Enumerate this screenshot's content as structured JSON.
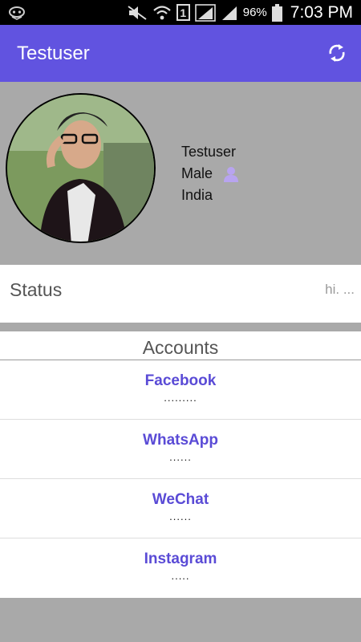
{
  "statusbar": {
    "battery_pct": "96%",
    "sim_slot": "1",
    "time": "7:03 PM",
    "icons": [
      "notification-icon",
      "mute-icon",
      "wifi-icon",
      "sim-1-icon",
      "signal-icon",
      "signal-icon",
      "battery-icon"
    ]
  },
  "appbar": {
    "title": "Testuser",
    "refresh_icon": "refresh-icon",
    "bg_color": "#6153e0"
  },
  "profile": {
    "name": "Testuser",
    "gender": "Male",
    "country": "India",
    "gender_icon": "person-icon"
  },
  "status": {
    "label": "Status",
    "value": "hi. ..."
  },
  "accounts": {
    "header": "Accounts",
    "items": [
      {
        "name": "Facebook",
        "value": "........."
      },
      {
        "name": "WhatsApp",
        "value": "......"
      },
      {
        "name": "WeChat",
        "value": "......"
      },
      {
        "name": "Instagram",
        "value": "....."
      }
    ],
    "accent_color": "#5a4bd6"
  }
}
